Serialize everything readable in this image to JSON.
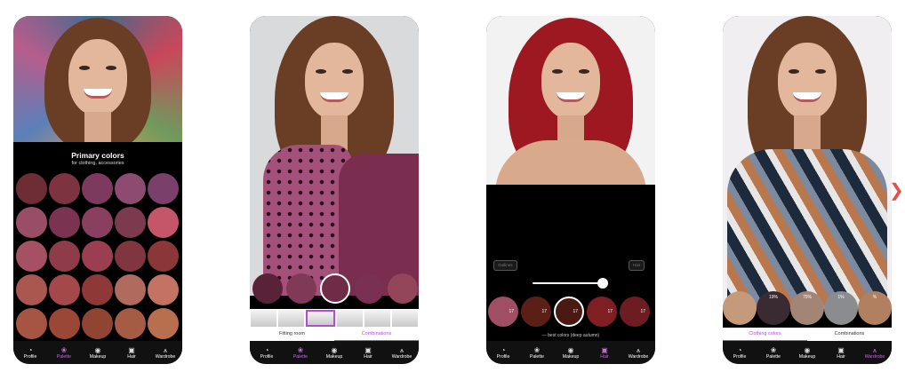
{
  "screens": [
    {
      "panel_title": "Primary colors",
      "panel_subtitle": "for clothing, accessories",
      "swatches": [
        "#6d2d35",
        "#7e3440",
        "#7e3a5e",
        "#8e4b72",
        "#7a3f6a",
        "#9a4d67",
        "#7a3452",
        "#8a3f60",
        "#7c3a4f",
        "#c5566a",
        "#a55063",
        "#8f3c4a",
        "#9c3e52",
        "#7f3640",
        "#8a3737",
        "#a9574f",
        "#a4484c",
        "#8e3938",
        "#b06a5e",
        "#c27363",
        "#a55541",
        "#9b4736",
        "#904432",
        "#a65c44",
        "#b76f4d"
      ]
    },
    {
      "color_swatches": [
        "#5a2238",
        "#803a58",
        "#6e2c46",
        "#7a3050",
        "#93465a"
      ],
      "tabs": [
        "Fitting room",
        "Combinations"
      ]
    },
    {
      "pills": [
        "Outlines",
        "Hair"
      ],
      "hair_swatches": [
        {
          "label": "17",
          "color": "#a04e64"
        },
        {
          "label": "17",
          "color": "#5c1f18"
        },
        {
          "label": "17",
          "color": "#4a1a12"
        },
        {
          "label": "17",
          "color": "#7f1f24"
        },
        {
          "label": "17",
          "color": "#6d1c22"
        }
      ],
      "caption": "— best colors (deep autumn)"
    },
    {
      "clothing_swatches": [
        {
          "label": "",
          "color": "#c49a7a"
        },
        {
          "label": "19%",
          "color": "#3a2a32"
        },
        {
          "label": "75%",
          "color": "#a38576"
        },
        {
          "label": "1%",
          "color": "#8b8c90"
        },
        {
          "label": "%",
          "color": "#b08060"
        }
      ],
      "tabs": [
        "Clothing colors",
        "Combinations"
      ]
    }
  ],
  "nav": [
    {
      "label": "Profile",
      "icon": "profile-icon"
    },
    {
      "label": "Palette",
      "icon": "palette-icon"
    },
    {
      "label": "Makeup",
      "icon": "makeup-icon"
    },
    {
      "label": "Hair",
      "icon": "hair-icon"
    },
    {
      "label": "Wardrobe",
      "icon": "wardrobe-icon"
    }
  ],
  "active_nav": [
    1,
    1,
    3,
    4
  ],
  "colors": {
    "accent": "#b24dd3",
    "chevron": "#e74b4b"
  }
}
